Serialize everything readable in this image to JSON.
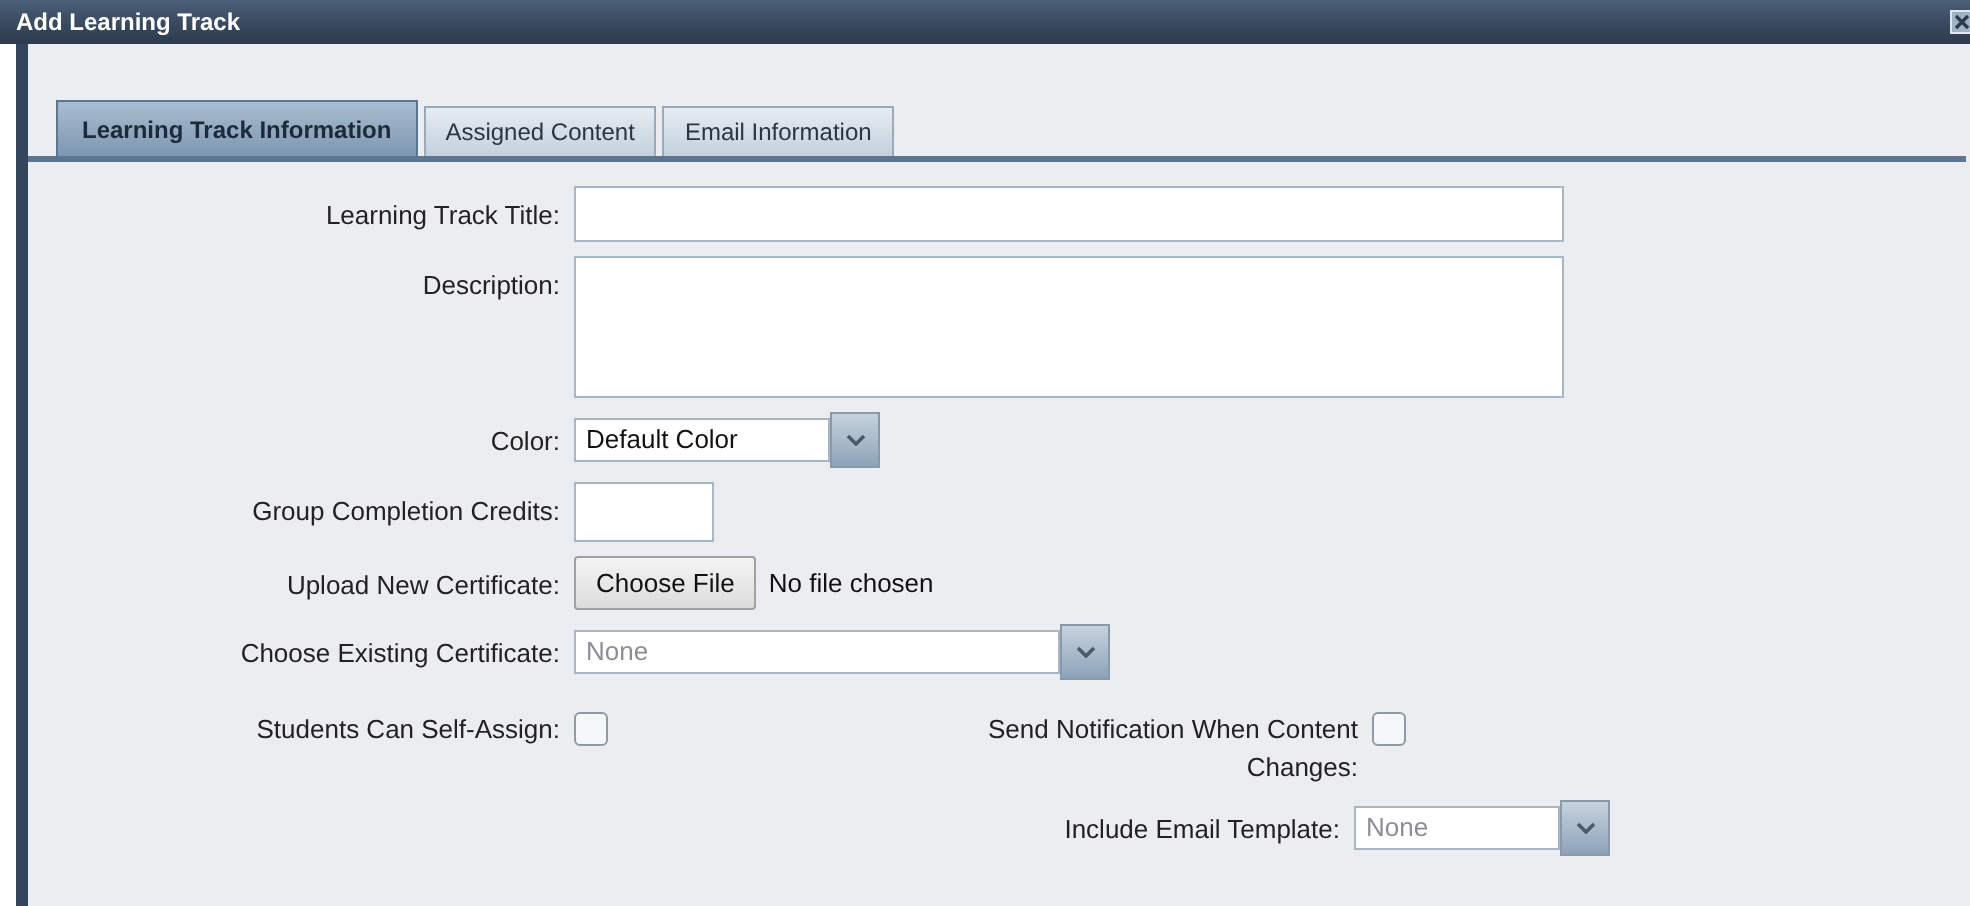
{
  "window": {
    "title": "Add Learning Track"
  },
  "tabs": [
    {
      "label": "Learning Track Information",
      "selected": true
    },
    {
      "label": "Assigned Content",
      "selected": false
    },
    {
      "label": "Email Information",
      "selected": false
    }
  ],
  "fields": [
    {
      "kind": "text",
      "label": "Learning Track Title:"
    },
    {
      "kind": "textarea",
      "label": "Description:"
    },
    {
      "kind": "select",
      "label": "Color:",
      "value": "Default Color",
      "disabled": false
    },
    {
      "kind": "short",
      "label": "Group Completion Credits:"
    },
    {
      "kind": "file",
      "label": "Upload New Certificate:",
      "button": "Choose File",
      "status": "No file chosen"
    },
    {
      "kind": "wideselect",
      "label": "Choose Existing Certificate:",
      "value": "None",
      "disabled": true
    }
  ],
  "options": [
    {
      "label": "Students Can Self-Assign:",
      "checked": false
    },
    {
      "label": "Send Notification When Content Changes:",
      "checked": false
    }
  ],
  "email_template": {
    "label": "Include Email Template:",
    "value": "None",
    "disabled": true
  }
}
